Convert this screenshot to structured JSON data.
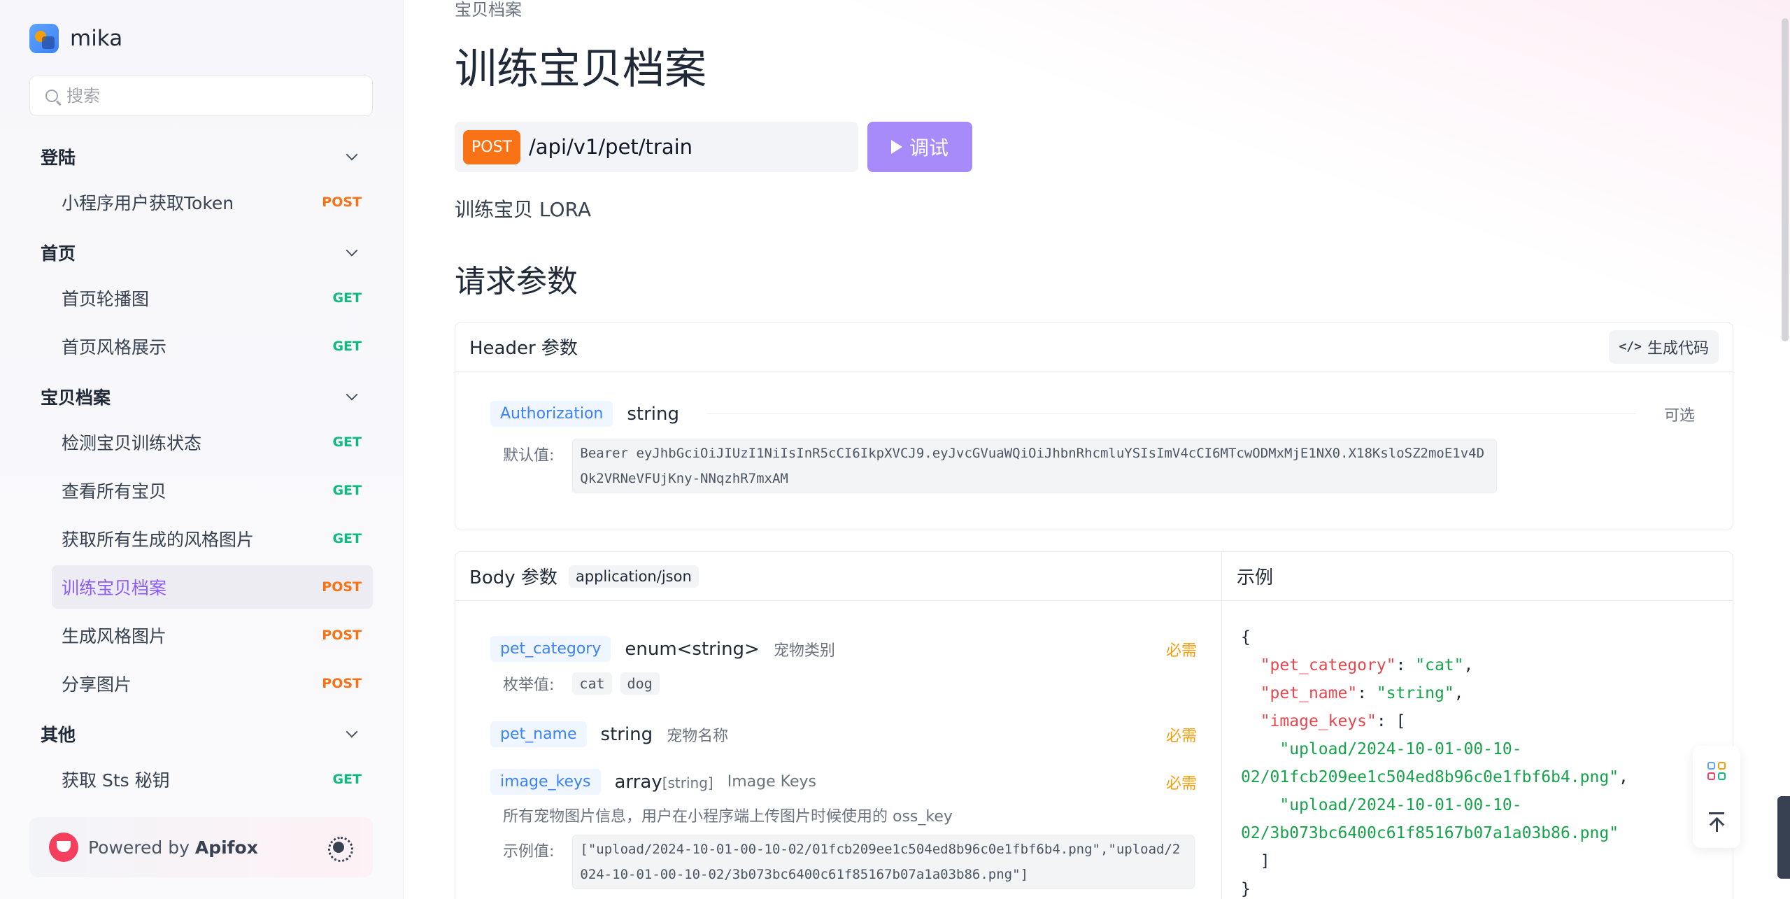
{
  "brand": {
    "name": "mika"
  },
  "search": {
    "placeholder": "搜索"
  },
  "nav": {
    "groups": [
      {
        "label": "登陆",
        "items": [
          {
            "label": "小程序用户获取Token",
            "method": "POST"
          }
        ]
      },
      {
        "label": "首页",
        "items": [
          {
            "label": "首页轮播图",
            "method": "GET"
          },
          {
            "label": "首页风格展示",
            "method": "GET"
          }
        ]
      },
      {
        "label": "宝贝档案",
        "items": [
          {
            "label": "检测宝贝训练状态",
            "method": "GET"
          },
          {
            "label": "查看所有宝贝",
            "method": "GET"
          },
          {
            "label": "获取所有生成的风格图片",
            "method": "GET"
          },
          {
            "label": "训练宝贝档案",
            "method": "POST",
            "active": true
          },
          {
            "label": "生成风格图片",
            "method": "POST"
          },
          {
            "label": "分享图片",
            "method": "POST"
          }
        ]
      },
      {
        "label": "其他",
        "items": [
          {
            "label": "获取 Sts 秘钥",
            "method": "GET"
          }
        ]
      }
    ]
  },
  "powered": {
    "prefix": "Powered by",
    "brand": "Apifox"
  },
  "page": {
    "breadcrumb": "宝贝档案",
    "title": "训练宝贝档案",
    "method": "POST",
    "path": "/api/v1/pet/train",
    "debug_label": "调试",
    "description": "训练宝贝 LORA",
    "section_title": "请求参数"
  },
  "header_params": {
    "title": "Header 参数",
    "gen_code": "生成代码",
    "items": [
      {
        "name": "Authorization",
        "type": "string",
        "flag": "可选",
        "default_label": "默认值:",
        "default_value": "Bearer eyJhbGciOiJIUzI1NiIsInR5cCI6IkpXVCJ9.eyJvcGVuaWQiOiJhbnRhcmluYSIsImV4cCI6MTcwODMxMjE1NX0.X18KsloSZ2moE1v4DQk2VRNeVFUjKny-NNqzhR7mxAM"
      }
    ]
  },
  "body_params": {
    "title": "Body 参数",
    "content_type": "application/json",
    "items": [
      {
        "name": "pet_category",
        "type": "enum<string>",
        "desc": "宠物类别",
        "flag": "必需",
        "enum_label": "枚举值:",
        "enum": [
          "cat",
          "dog"
        ]
      },
      {
        "name": "pet_name",
        "type": "string",
        "desc": "宠物名称",
        "flag": "必需"
      },
      {
        "name": "image_keys",
        "type": "array",
        "subtype": "[string]",
        "desc": "Image Keys",
        "flag": "必需",
        "note": "所有宠物图片信息，用户在小程序端上传图片时候使用的 oss_key",
        "example_label": "示例值:",
        "example_value": "[\"upload/2024-10-01-00-10-02/01fcb209ee1c504ed8b96c0e1fbf6b4.png\",\"upload/2024-10-01-00-10-02/3b073bc6400c61f85167b07a1a03b86.png\"]"
      }
    ]
  },
  "example": {
    "title": "示例",
    "lines": [
      {
        "t": "{"
      },
      {
        "k": "\"pet_category\"",
        "v": "\"cat\"",
        "end": ","
      },
      {
        "k": "\"pet_name\"",
        "v": "\"string\"",
        "end": ","
      },
      {
        "k": "\"image_keys\"",
        "v": "",
        "end": ": ["
      },
      {
        "s": "\"upload/2024-10-01-00-10-",
        "indent": 2
      },
      {
        "s": "02/01fcb209ee1c504ed8b96c0e1fbf6b4.png\"",
        "end": ",",
        "indent": 0
      },
      {
        "s": "\"upload/2024-10-01-00-10-",
        "indent": 2
      },
      {
        "s": "02/3b073bc6400c61f85167b07a1a03b86.png\"",
        "indent": 0
      },
      {
        "t": "  ]"
      },
      {
        "t": "}"
      }
    ]
  }
}
